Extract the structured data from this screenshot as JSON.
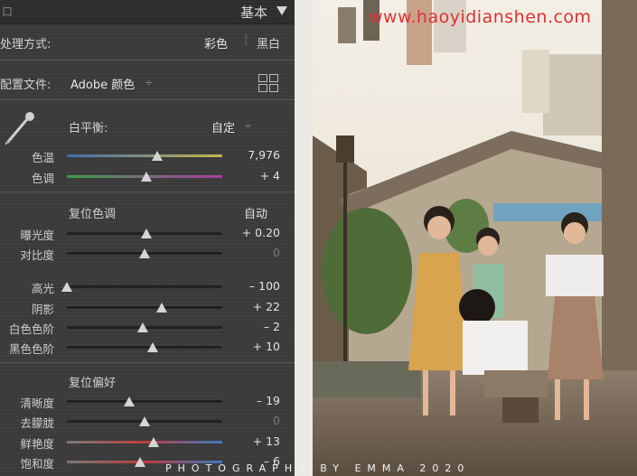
{
  "watermark": "www.haoyidianshen.com",
  "credit": "PHOTOGRAPHY BY EMMA 2020",
  "header": {
    "title": "基本",
    "corner": "口"
  },
  "treatment": {
    "label": "处理方式:",
    "color": "彩色",
    "bw": "黑白"
  },
  "profile": {
    "label": "配置文件:",
    "value": "Adobe 颜色",
    "arrow": "÷"
  },
  "wb": {
    "label": "白平衡:",
    "value": "自定",
    "arrow": "÷"
  },
  "sliders": {
    "temp": {
      "label": "色温",
      "value": "7,976",
      "pos": 0.58
    },
    "tint": {
      "label": "色调",
      "value": "+ 4",
      "pos": 0.51
    }
  },
  "tone": {
    "title": "复位色调",
    "auto": "自动"
  },
  "tone_sliders": [
    {
      "label": "曝光度",
      "value": "+ 0.20",
      "pos": 0.51,
      "dim": false
    },
    {
      "label": "对比度",
      "value": "0",
      "pos": 0.5,
      "dim": true
    },
    {
      "label": "高光",
      "value": "– 100",
      "pos": 0.0,
      "dim": false
    },
    {
      "label": "阴影",
      "value": "+ 22",
      "pos": 0.61,
      "dim": false
    },
    {
      "label": "白色色阶",
      "value": "– 2",
      "pos": 0.49,
      "dim": false
    },
    {
      "label": "黑色色阶",
      "value": "+ 10",
      "pos": 0.55,
      "dim": false
    }
  ],
  "presence": {
    "title": "复位偏好"
  },
  "presence_sliders": [
    {
      "label": "清晰度",
      "value": "– 19",
      "pos": 0.4,
      "dim": false
    },
    {
      "label": "去朦胧",
      "value": "0",
      "pos": 0.5,
      "dim": true
    },
    {
      "label": "鲜艳度",
      "value": "+ 13",
      "pos": 0.56,
      "dim": false
    },
    {
      "label": "饱和度",
      "value": "– 6",
      "pos": 0.47,
      "dim": false
    }
  ],
  "colors": {
    "panel": "#3b3b3b",
    "watermark": "#e03030"
  }
}
